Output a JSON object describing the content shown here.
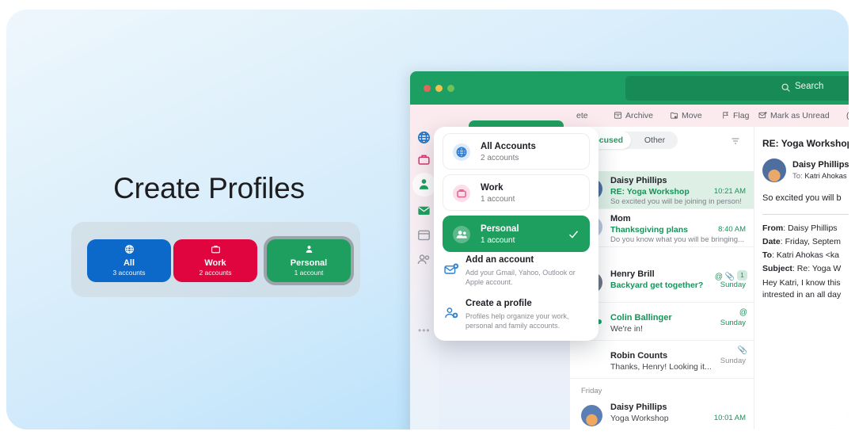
{
  "promo": {
    "title": "Create Profiles",
    "chips": [
      {
        "name": "All",
        "sub": "3 accounts",
        "icon": "globe-icon",
        "color": "#0c68c9"
      },
      {
        "name": "Work",
        "sub": "2 accounts",
        "icon": "briefcase-icon",
        "color": "#e0053f"
      },
      {
        "name": "Personal",
        "sub": "1 account",
        "icon": "person-icon",
        "color": "#1f9f5f"
      }
    ]
  },
  "app": {
    "titlebar": {
      "traffic_lights": [
        "close-red",
        "minimize-yellow",
        "zoom-green"
      ],
      "search_placeholder": "Search",
      "search_icon": "search-icon"
    },
    "toolbar": [
      {
        "label": "ete",
        "icon": "trash-icon"
      },
      {
        "label": "Archive",
        "icon": "archive-box-icon"
      },
      {
        "label": "Move",
        "icon": "move-folder-icon"
      },
      {
        "label": "Flag",
        "icon": "flag-icon"
      },
      {
        "label": "Mark as Unread",
        "icon": "envelope-dot-icon"
      },
      {
        "label": "(",
        "icon": "more-icon"
      }
    ],
    "rail": [
      {
        "icon": "globe-icon",
        "color": "#1a73c8"
      },
      {
        "icon": "briefcase-icon",
        "color": "#d6336c"
      },
      {
        "icon": "person-icon",
        "color": "#1f9f5f"
      },
      {
        "icon": "mail-icon",
        "color": "#1f9f5f"
      },
      {
        "icon": "calendar-icon",
        "color": "#9a9aa6"
      },
      {
        "icon": "people-icon",
        "color": "#9a9aa6"
      },
      {
        "icon": "more-dots-icon",
        "color": "#b4b0bb"
      }
    ]
  },
  "list": {
    "tabs": [
      {
        "label": "Focused",
        "active": true
      },
      {
        "label": "Other",
        "active": false
      }
    ],
    "filter_icon": "filter-icon",
    "groups": [
      {
        "day": "y",
        "messages": [
          {
            "sender": "Daisy Phillips",
            "subject": "RE: Yoga Workshop",
            "preview": "So excited you will be joining in person!",
            "time": "10:21 AM",
            "selected": true,
            "meta": "",
            "avatar_initial": "",
            "avatar_style": "photo-a",
            "unread_dot": false,
            "sender_green": false,
            "subject_plain": false
          },
          {
            "sender": "Mom",
            "subject": "Thanksgiving plans",
            "preview": "Do you know what you will be bringing...",
            "time": "8:40 AM",
            "selected": false,
            "meta": "",
            "avatar_initial": "M",
            "avatar_style": "",
            "unread_dot": false,
            "sender_green": false,
            "subject_plain": false
          }
        ]
      },
      {
        "day": "rday",
        "messages": [
          {
            "sender": "Henry Brill",
            "subject": "Backyard get together?",
            "preview": "",
            "time": "Sunday",
            "selected": false,
            "meta": "@ 1",
            "avatar_initial": "",
            "avatar_style": "photo-b",
            "unread_dot": false,
            "sender_green": false,
            "subject_plain": false
          },
          {
            "sender": "Colin Ballinger",
            "subject": "We're in!",
            "preview": "",
            "time": "Sunday",
            "selected": false,
            "meta": "@",
            "avatar_initial": "",
            "avatar_style": "",
            "unread_dot": true,
            "sender_green": true,
            "subject_plain": true
          },
          {
            "sender": "Robin Counts",
            "subject": "Thanks, Henry! Looking it...",
            "preview": "",
            "time": "Sunday",
            "selected": false,
            "meta": "clip",
            "avatar_initial": "",
            "avatar_style": "",
            "unread_dot": false,
            "sender_green": false,
            "subject_plain": true
          }
        ]
      },
      {
        "day": "Friday",
        "messages": [
          {
            "sender": "Daisy Phillips",
            "subject": "Yoga Workshop",
            "preview": "",
            "time": "10:01 AM",
            "selected": false,
            "meta": "",
            "avatar_initial": "",
            "avatar_style": "photo-c",
            "unread_dot": false,
            "sender_green": false,
            "subject_plain": true
          }
        ]
      }
    ]
  },
  "reading": {
    "subject": "RE: Yoga Workshop",
    "from_name": "Daisy Phillips",
    "to_prefix": "To:",
    "to_value": "Katri Ahokas",
    "body_line": "So excited you will b",
    "quoted": [
      {
        "label": "From",
        "value": "Daisy Phillips"
      },
      {
        "label": "Date",
        "value": "Friday, Septem"
      },
      {
        "label": "To",
        "value": "Katri Ahokas <ka"
      },
      {
        "label": "Subject",
        "value": "Re: Yoga W"
      }
    ],
    "quoted_body": [
      "Hey Katri, I know this",
      "intrested in an all day"
    ]
  },
  "dropdown": {
    "accounts": [
      {
        "title": "All Accounts",
        "sub": "2 accounts",
        "icon": "globe-icon",
        "active": false
      },
      {
        "title": "Work",
        "sub": "1 account",
        "icon": "briefcase-icon",
        "active": false
      },
      {
        "title": "Personal",
        "sub": "1 account",
        "icon": "people-icon",
        "active": true
      }
    ],
    "check_icon": "check-icon",
    "actions": [
      {
        "title": "Add an account",
        "sub": "Add your Gmail, Yahoo, Outlook or Apple account.",
        "icon": "add-mail-icon"
      },
      {
        "title": "Create a profile",
        "sub": "Profiles help organize your work, personal and family accounts.",
        "icon": "add-person-icon"
      }
    ]
  },
  "colors": {
    "brand_green": "#1f9f5f",
    "header_green": "#1d9e63",
    "accent_blue": "#0c68c9",
    "accent_red": "#e0053f",
    "selected_row": "#def0e6"
  }
}
